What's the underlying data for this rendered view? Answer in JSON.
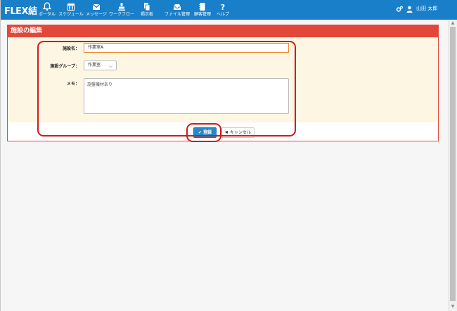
{
  "app": {
    "logo": "FLEX結"
  },
  "nav": [
    {
      "label": "ポータル",
      "icon": "bell-icon"
    },
    {
      "label": "スケジュール",
      "icon": "calendar-icon"
    },
    {
      "label": "メッセージ",
      "icon": "envelope-icon"
    },
    {
      "label": "ワークフロー",
      "icon": "stamp-icon"
    },
    {
      "label": "掲示板",
      "icon": "bulletin-icon"
    },
    {
      "label": "ファイル管理",
      "icon": "inbox-icon"
    },
    {
      "label": "顧客管理",
      "icon": "address-book-icon"
    },
    {
      "label": "ヘルプ",
      "icon": "question-icon"
    }
  ],
  "topbar_right": {
    "settings_icon": "gears-icon",
    "user_icon": "user-icon",
    "user_name": "山田 太郎"
  },
  "panel": {
    "title": "施設の編集"
  },
  "form": {
    "name_label": "施設名：",
    "name_value": "作業室A",
    "group_label": "施設グループ：",
    "group_value": "作業室",
    "memo_label": "メモ：",
    "memo_value": "旋盤機材あり"
  },
  "buttons": {
    "register": "登録",
    "cancel": "キャンセル"
  },
  "colors": {
    "topbar": "#1a7fc9",
    "panel_header": "#e2473a",
    "primary_button": "#2a87c7",
    "annotation": "#d21a1a",
    "field_focus": "#f08a2c"
  }
}
